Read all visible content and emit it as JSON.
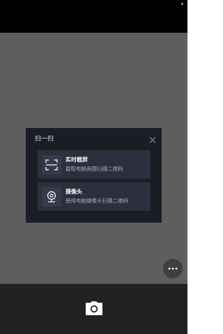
{
  "colors": {
    "status_indicator": "#3fd45c",
    "dialog_background": "#1b1d25",
    "option_background": "#2c2f3d",
    "icon_color": "#e8e9ee"
  },
  "dialog": {
    "title": "扫一扫",
    "close_icon": "close-icon",
    "options": [
      {
        "icon": "screenshot-scan-icon",
        "title": "实时截屏",
        "description": "截取电脑画面扫描二维码"
      },
      {
        "icon": "webcam-icon",
        "title": "摄像头",
        "description": "使用电脑摄像头扫描二维码"
      }
    ]
  },
  "floating": {
    "more_icon": "more-dots-icon"
  },
  "bottom_bar": {
    "camera_icon": "camera-icon"
  }
}
